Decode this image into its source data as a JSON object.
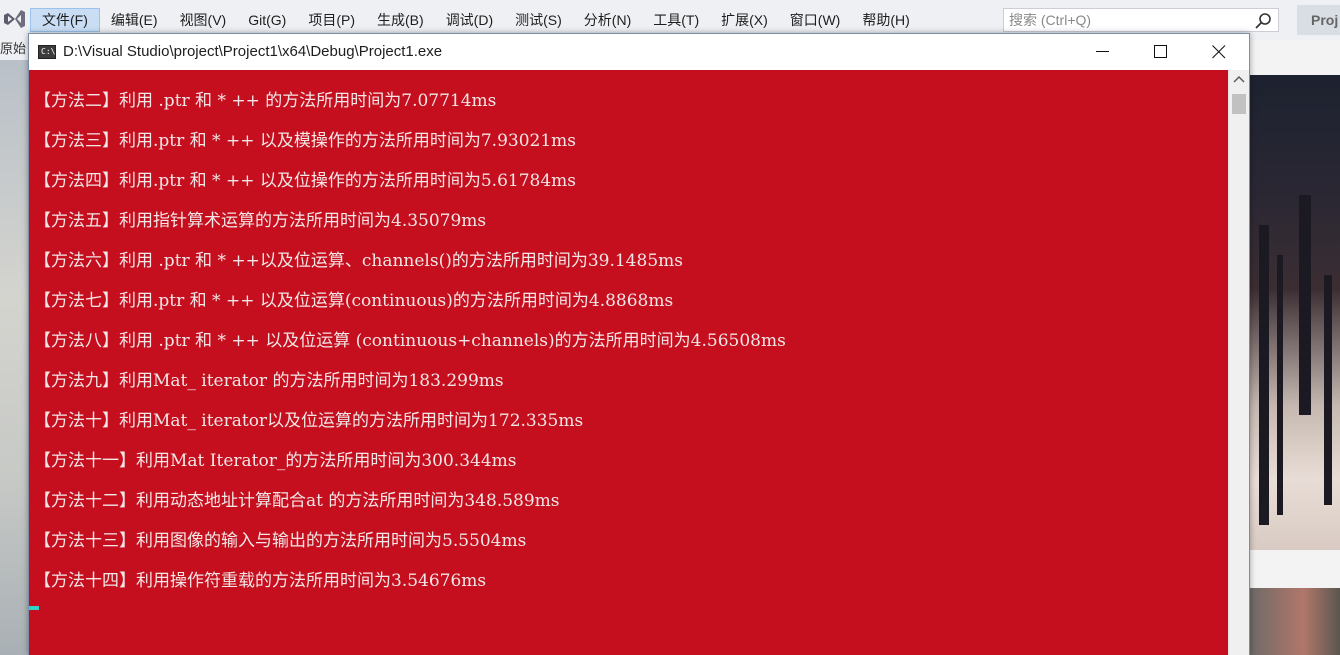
{
  "vs": {
    "menu": [
      "文件(F)",
      "编辑(E)",
      "视图(V)",
      "Git(G)",
      "项目(P)",
      "生成(B)",
      "调试(D)",
      "测试(S)",
      "分析(N)",
      "工具(T)",
      "扩展(X)",
      "窗口(W)",
      "帮助(H)"
    ],
    "search_placeholder": "搜索 (Ctrl+Q)",
    "project_tab": "Proj",
    "sidebar_label": "原始"
  },
  "console": {
    "icon_text": "C:\\",
    "title": "D:\\Visual Studio\\project\\Project1\\x64\\Debug\\Project1.exe",
    "background": "#c50f1f",
    "text_color": "#f3e6e6",
    "lines": [
      "【方法二】利用 .ptr 和 * ++ 的方法所用时间为7.07714ms",
      "【方法三】利用.ptr 和 * ++ 以及模操作的方法所用时间为7.93021ms",
      "【方法四】利用.ptr 和 * ++ 以及位操作的方法所用时间为5.61784ms",
      "【方法五】利用指针算术运算的方法所用时间为4.35079ms",
      "【方法六】利用 .ptr 和 * ++以及位运算、channels()的方法所用时间为39.1485ms",
      "【方法七】利用.ptr 和 * ++ 以及位运算(continuous)的方法所用时间为4.8868ms",
      "【方法八】利用 .ptr 和 * ++ 以及位运算 (continuous+channels)的方法所用时间为4.56508ms",
      "【方法九】利用Mat_ iterator 的方法所用时间为183.299ms",
      "【方法十】利用Mat_ iterator以及位运算的方法所用时间为172.335ms",
      "【方法十一】利用Mat Iterator_的方法所用时间为300.344ms",
      "【方法十二】利用动态地址计算配合at 的方法所用时间为348.589ms",
      "【方法十三】利用图像的输入与输出的方法所用时间为5.5504ms",
      "【方法十四】利用操作符重载的方法所用时间为3.54676ms"
    ]
  }
}
